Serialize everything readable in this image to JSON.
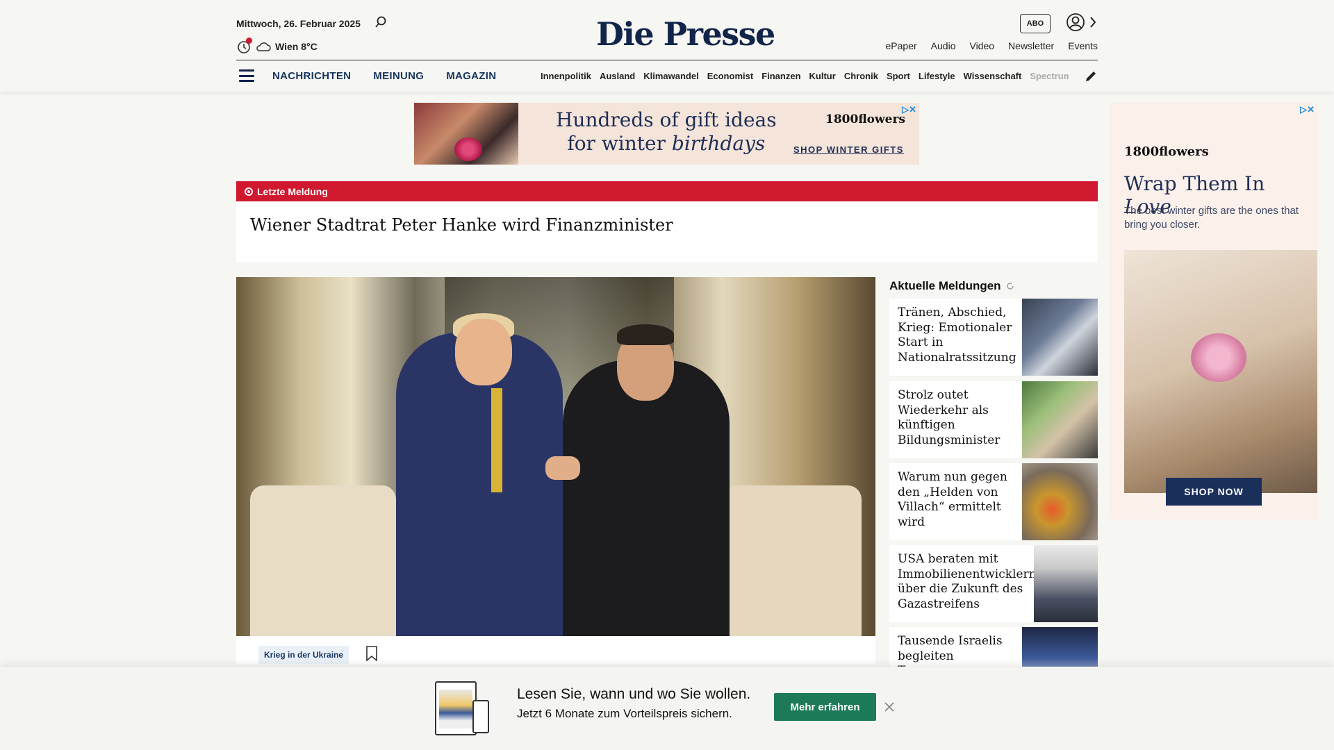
{
  "header": {
    "date": "Mittwoch, 26. Februar 2025",
    "weather": "Wien 8°C",
    "logo": "Die Presse",
    "abo_label": "ABO",
    "top_links": [
      "ePaper",
      "Audio",
      "Video",
      "Newsletter",
      "Events"
    ],
    "main_nav": [
      "NACHRICHTEN",
      "MEINUNG",
      "MAGAZIN"
    ],
    "sub_nav": [
      "Innenpolitik",
      "Ausland",
      "Klimawandel",
      "Economist",
      "Finanzen",
      "Kultur",
      "Chronik",
      "Sport",
      "Lifestyle",
      "Wissenschaft",
      "Spectrum"
    ]
  },
  "ads": {
    "top": {
      "line1": "Hundreds of gift ideas",
      "line2_a": "for winter ",
      "line2_b": "birthdays",
      "brand": "1800flowers",
      "cta": "SHOP WINTER GIFTS"
    },
    "side": {
      "brand": "1800flowers",
      "headline_a": "Wrap Them In ",
      "headline_b": "Love",
      "sub": "The best winter gifts are the ones that bring you closer.",
      "cta": "SHOP NOW"
    }
  },
  "breaking": {
    "label": "Letzte Meldung",
    "headline": "Wiener Stadtrat Peter Hanke wird Finanzminister"
  },
  "hero": {
    "tag": "Krieg in der Ukraine"
  },
  "news": {
    "title": "Aktuelle Meldungen",
    "items": [
      "Tränen, Abschied, Krieg: Emotionaler Start in Nationalratssitzung",
      "Strolz outet Wiederkehr als künftigen Bildungsminister",
      "Warum nun gegen den „Helden von Villach“ ermittelt wird",
      "USA beraten mit Immobilienentwicklern über die Zukunft des Gazastreifens",
      "Tausende Israelis begleiten Trauerzug"
    ]
  },
  "promo": {
    "line1": "Lesen Sie, wann und wo Sie wollen.",
    "line2": "Jetzt 6 Monate zum Vorteilspreis sichern.",
    "button": "Mehr erfahren"
  }
}
